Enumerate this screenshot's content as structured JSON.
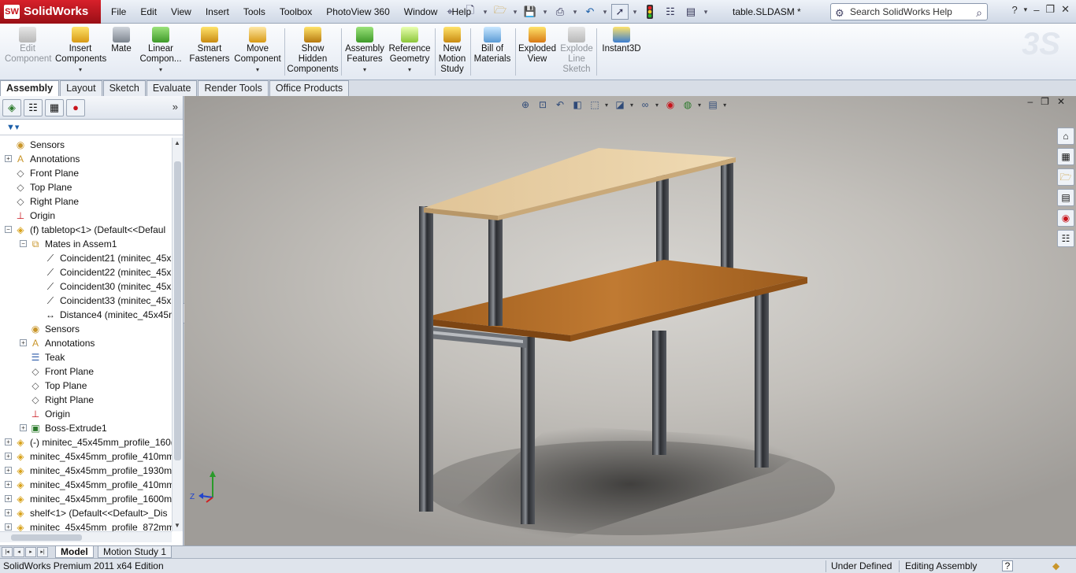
{
  "app": {
    "name": "SolidWorks",
    "logo_badge": "SW",
    "document_title": "table.SLDASM *"
  },
  "menu": [
    "File",
    "Edit",
    "View",
    "Insert",
    "Tools",
    "Toolbox",
    "PhotoView 360",
    "Window",
    "Help"
  ],
  "search": {
    "placeholder": "Search SolidWorks Help"
  },
  "window_controls": {
    "help": "?",
    "minimize": "–",
    "restore": "❐",
    "close": "✕"
  },
  "ribbon": [
    {
      "label": "Edit\nComponent",
      "enabled": false
    },
    {
      "label": "Insert\nComponents",
      "enabled": true,
      "dropdown": true
    },
    {
      "label": "Mate",
      "enabled": true
    },
    {
      "label": "Linear\nCompon...",
      "enabled": true,
      "dropdown": true
    },
    {
      "label": "Smart\nFasteners",
      "enabled": true
    },
    {
      "label": "Move\nComponent",
      "enabled": true,
      "dropdown": true
    },
    {
      "label": "Show\nHidden\nComponents",
      "enabled": true
    },
    {
      "label": "Assembly\nFeatures",
      "enabled": true,
      "dropdown": true
    },
    {
      "label": "Reference\nGeometry",
      "enabled": true,
      "dropdown": true
    },
    {
      "label": "New\nMotion\nStudy",
      "enabled": true
    },
    {
      "label": "Bill of\nMaterials",
      "enabled": true
    },
    {
      "label": "Exploded\nView",
      "enabled": true
    },
    {
      "label": "Explode\nLine\nSketch",
      "enabled": false
    },
    {
      "label": "Instant3D",
      "enabled": true
    }
  ],
  "tabs": [
    "Assembly",
    "Layout",
    "Sketch",
    "Evaluate",
    "Render Tools",
    "Office Products"
  ],
  "active_tab": "Assembly",
  "tree": [
    {
      "label": "Sensors",
      "level": 0,
      "icon": "sensor-icon",
      "expand": ""
    },
    {
      "label": "Annotations",
      "level": 0,
      "icon": "annotation-icon",
      "expand": "+"
    },
    {
      "label": "Front Plane",
      "level": 0,
      "icon": "plane-icon",
      "expand": ""
    },
    {
      "label": "Top Plane",
      "level": 0,
      "icon": "plane-icon",
      "expand": ""
    },
    {
      "label": "Right Plane",
      "level": 0,
      "icon": "plane-icon",
      "expand": ""
    },
    {
      "label": "Origin",
      "level": 0,
      "icon": "origin-icon",
      "expand": ""
    },
    {
      "label": "(f) tabletop<1> (Default<<Defaul",
      "level": 0,
      "icon": "part-icon",
      "expand": "−"
    },
    {
      "label": "Mates in Assem1",
      "level": 1,
      "icon": "mates-folder-icon",
      "expand": "−"
    },
    {
      "label": "Coincident21 (minitec_45x",
      "level": 2,
      "icon": "coincident-mate-icon",
      "expand": ""
    },
    {
      "label": "Coincident22 (minitec_45x",
      "level": 2,
      "icon": "coincident-mate-icon",
      "expand": ""
    },
    {
      "label": "Coincident30 (minitec_45x",
      "level": 2,
      "icon": "coincident-mate-icon",
      "expand": ""
    },
    {
      "label": "Coincident33 (minitec_45x",
      "level": 2,
      "icon": "coincident-mate-icon",
      "expand": ""
    },
    {
      "label": "Distance4 (minitec_45x45m",
      "level": 2,
      "icon": "distance-mate-icon",
      "expand": ""
    },
    {
      "label": "Sensors",
      "level": 1,
      "icon": "sensor-icon",
      "expand": ""
    },
    {
      "label": "Annotations",
      "level": 1,
      "icon": "annotation-icon",
      "expand": "+"
    },
    {
      "label": "Teak",
      "level": 1,
      "icon": "material-icon",
      "expand": ""
    },
    {
      "label": "Front Plane",
      "level": 1,
      "icon": "plane-icon",
      "expand": ""
    },
    {
      "label": "Top Plane",
      "level": 1,
      "icon": "plane-icon",
      "expand": ""
    },
    {
      "label": "Right Plane",
      "level": 1,
      "icon": "plane-icon",
      "expand": ""
    },
    {
      "label": "Origin",
      "level": 1,
      "icon": "origin-icon",
      "expand": ""
    },
    {
      "label": "Boss-Extrude1",
      "level": 1,
      "icon": "extrude-icon",
      "expand": "+"
    },
    {
      "label": "(-) minitec_45x45mm_profile_160(",
      "level": 0,
      "icon": "part-icon",
      "expand": "+"
    },
    {
      "label": "minitec_45x45mm_profile_410mm",
      "level": 0,
      "icon": "part-icon",
      "expand": "+"
    },
    {
      "label": "minitec_45x45mm_profile_1930m",
      "level": 0,
      "icon": "part-icon",
      "expand": "+"
    },
    {
      "label": "minitec_45x45mm_profile_410mm",
      "level": 0,
      "icon": "part-icon",
      "expand": "+"
    },
    {
      "label": "minitec_45x45mm_profile_1600m",
      "level": 0,
      "icon": "part-icon",
      "expand": "+"
    },
    {
      "label": "shelf<1> (Default<<Default>_Dis",
      "level": 0,
      "icon": "part-icon",
      "expand": "+"
    },
    {
      "label": "minitec_45x45mm_profile_872mm",
      "level": 0,
      "icon": "part-icon",
      "expand": "+"
    }
  ],
  "bottom_tabs": [
    "Model",
    "Motion Study 1"
  ],
  "active_bottom_tab": "Model",
  "status": {
    "edition": "SolidWorks Premium 2011 x64 Edition",
    "state": "Under Defined",
    "mode": "Editing Assembly",
    "help": "?"
  },
  "colors": {
    "brand_red": "#c8141c",
    "tabletop_wood": "#b06a24",
    "shelf_wood": "#ead3a8",
    "profile_metal": "#3c3f44"
  }
}
